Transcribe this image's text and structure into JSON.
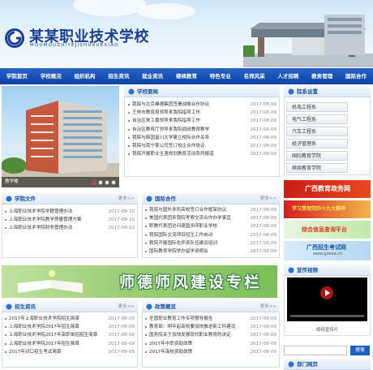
{
  "header": {
    "title": "某某职业技术学校",
    "subtitle": "MOUMOUZHIYEJISHUXUEXIAO"
  },
  "nav": [
    "学院首页",
    "学校概况",
    "组织机构",
    "招生资讯",
    "就业资讯",
    "继续教育",
    "特色专业",
    "名师风采",
    "人才招聘",
    "教务管理",
    "国际合作"
  ],
  "slideshow": {
    "caption": "教学楼",
    "dots": [
      "1",
      "2",
      "3",
      "4"
    ]
  },
  "news": {
    "title": "学校要闻",
    "more": "更多>>",
    "items": [
      {
        "t": "我院与北京峰德集团签署战略合作协议",
        "d": "2017-08-09"
      },
      {
        "t": "王林市教育局领导来我院指导工作",
        "d": "2017-08-09"
      },
      {
        "t": "自治区党工委领导来我院指导工作",
        "d": "2017-08-09"
      },
      {
        "t": "自治区教育厅领导来我院调研教育教学",
        "d": "2017-08-09"
      },
      {
        "t": "我院与韩国富川大学建立校际合作关系",
        "d": "2017-08-09"
      },
      {
        "t": "我院与南宁某公司签订校企合作协议",
        "d": "2017-08-09"
      },
      {
        "t": "我院开展职业生涯规划教育活动系列报道",
        "d": "2017-08-09"
      }
    ]
  },
  "departments": {
    "title": "院系设置",
    "items": [
      "机电工程系",
      "电气工程系",
      "汽车工程系",
      "经济管理系",
      "国际教育学院",
      "继续教育学院"
    ]
  },
  "docs": {
    "title": "学院文件",
    "more": "更多>>",
    "items": [
      {
        "t": "上海职业技术学院学籍管理办法",
        "d": "2017-08-10"
      },
      {
        "t": "上海职业技术学院教学质量管理方案",
        "d": "2017-08-10"
      },
      {
        "t": "上海职业技术学院财务管理办法",
        "d": "2017-08-10"
      }
    ]
  },
  "intl": {
    "title": "国际合作",
    "more": "更多>>",
    "items": [
      {
        "t": "我院与国外多所高校签订合作框架协议",
        "d": "2017-08-09"
      },
      {
        "t": "美国代表团来我院考察交流合作办学事宜",
        "d": "2017-08-09"
      },
      {
        "t": "职教代表团访问德国多所职业学校",
        "d": "2017-08-09"
      },
      {
        "t": "我院国际交流项目招生工作启动",
        "d": "2017-08-09"
      },
      {
        "t": "我院开展国际化师资队伍建设培训",
        "d": "2017-08-09"
      },
      {
        "t": "国际教育学院举办留学说明会",
        "d": "2017-08-09"
      }
    ]
  },
  "banners": {
    "b1": "广西教育政务网",
    "b2": "学习贯彻党的十九大精神",
    "b3": "综合信息查询平台",
    "b4": "广西招生考试网",
    "b4_sub": "www.gxeea.cn"
  },
  "teacher_banner": "师德师风建设专栏",
  "video": {
    "title": "宣传视频",
    "caption": "视频宣传片"
  },
  "admission": {
    "title": "招生资讯",
    "more": "更多>>",
    "items": [
      {
        "t": "2017年上海职业技术学院招生简章",
        "d": "2017-08-09"
      },
      {
        "t": "上海职业技术学院2017年招生简章",
        "d": "2017-08-09"
      },
      {
        "t": "上海职业技术学院2017年高职单招招生简章",
        "d": "2017-08-09"
      },
      {
        "t": "上海职业技术学院2017年招生简章",
        "d": "2017-08-09"
      },
      {
        "t": "2017年对口招生考试简章",
        "d": "2017-08-09"
      }
    ]
  },
  "policy": {
    "title": "政策概览",
    "more": "更多>>",
    "items": [
      {
        "t": "全国职业教育工作专项督导报告",
        "d": "2017-08-09"
      },
      {
        "t": "教育部：明年起高校要加快推进新工科建设",
        "d": "2017-08-09"
      },
      {
        "t": "国务院关于加快发展现代职业教育的决定",
        "d": "2017-08-09"
      },
      {
        "t": "2017年中职资助政策",
        "d": "2017-08-09"
      },
      {
        "t": "2017年高校资助政策",
        "d": "2017-08-09"
      }
    ]
  },
  "links": {
    "title": "部门网页",
    "search_button": "搜索"
  },
  "colors": {
    "nav": "#1148a8",
    "accent": "#1b55a6"
  }
}
